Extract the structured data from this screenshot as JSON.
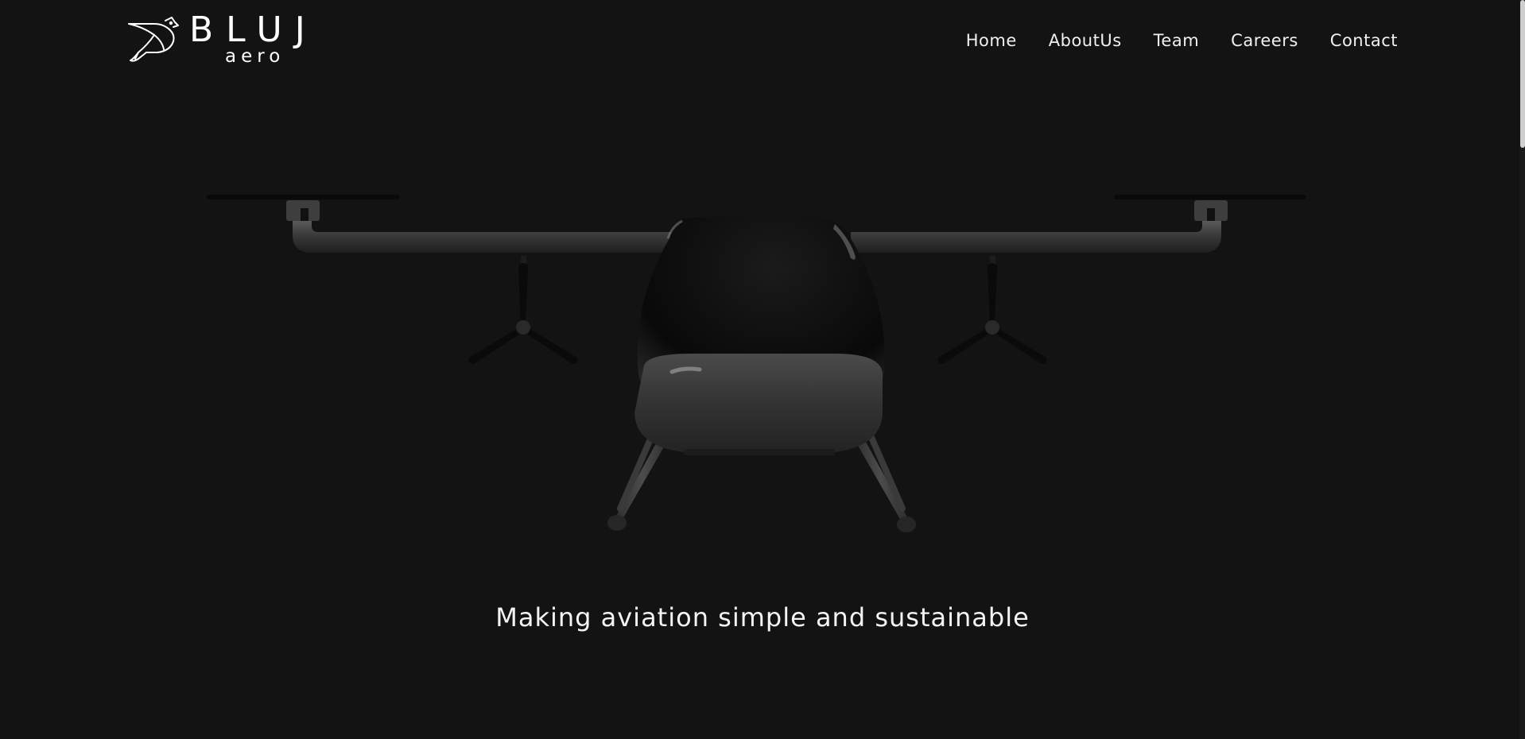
{
  "brand": {
    "name": "BLUJ",
    "subname": "aero",
    "logo_icon": "bird-icon"
  },
  "nav": {
    "items": [
      {
        "label": "Home"
      },
      {
        "label": "AboutUs"
      },
      {
        "label": "Team"
      },
      {
        "label": "Careers"
      },
      {
        "label": "Contact"
      }
    ]
  },
  "hero": {
    "image": "evtol-aircraft-render",
    "tagline": "Making aviation simple and sustainable"
  },
  "colors": {
    "background": "#131313",
    "text": "#f2f2f2"
  }
}
